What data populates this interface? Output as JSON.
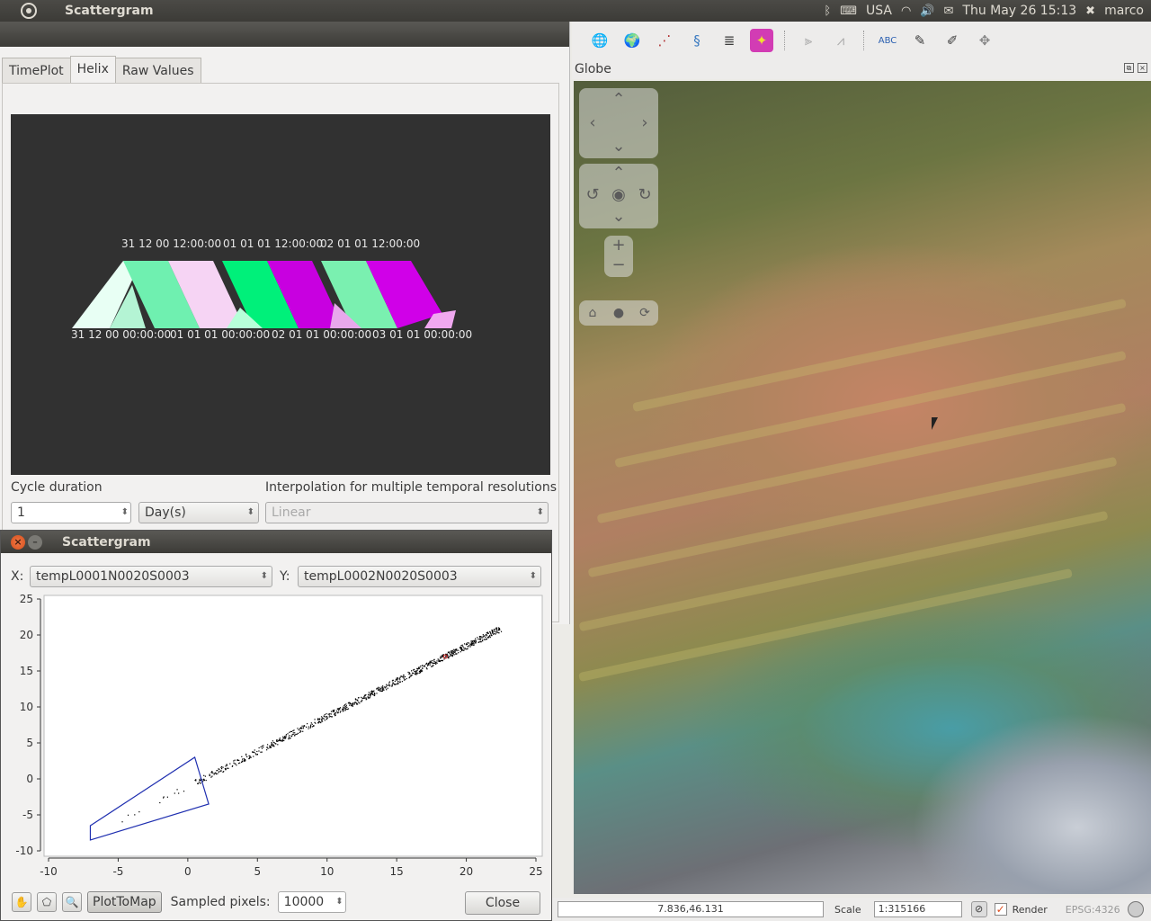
{
  "top_panel": {
    "app_title": "Scattergram",
    "keyboard": "USA",
    "datetime": "Thu May 26 15:13",
    "user": "marco"
  },
  "globe": {
    "title": "Globe"
  },
  "statusbar": {
    "coordinates": "7.836,46.131",
    "scale_label": "Scale",
    "scale_value": "1:315166",
    "render_label": "Render",
    "crs": "EPSG:4326"
  },
  "helix_dialog": {
    "tabs": [
      {
        "label": "TimePlot"
      },
      {
        "label": "Helix"
      },
      {
        "label": "Raw Values"
      }
    ],
    "top_labels": [
      "31 12 00 12:00:00",
      "01 01 01 12:00:00",
      "02 01 01 12:00:00"
    ],
    "bottom_labels": [
      "31 12 00 00:00:00",
      "01 01 01 00:00:00",
      "02 01 01 00:00:00",
      "03 01 01 00:00:00"
    ],
    "cycle_duration_label": "Cycle duration",
    "cycle_duration_value": "1",
    "cycle_unit": "Day(s)",
    "interpolation_label": "Interpolation for multiple temporal resolutions",
    "interpolation_value": "Linear"
  },
  "scatter_dialog": {
    "title": "Scattergram",
    "x_label": "X:",
    "x_value": "tempL0001N0020S0003",
    "y_label": "Y:",
    "y_value": "tempL0002N0020S0003",
    "plot_to_map_label": "PlotToMap",
    "sampled_label": "Sampled pixels:",
    "sampled_value": "10000",
    "close_label": "Close"
  },
  "chart_data": {
    "type": "scatter",
    "xlim": [
      -10,
      25
    ],
    "ylim": [
      -10,
      25
    ],
    "xticks": [
      -10,
      -5,
      0,
      5,
      10,
      15,
      20,
      25
    ],
    "yticks": [
      -10,
      -5,
      0,
      5,
      10,
      15,
      20,
      25
    ],
    "trend": {
      "x_start": -7,
      "y_start": -7.8,
      "x_end": 22.5,
      "y_end": 21
    },
    "selection_polygon": [
      [
        -7,
        -6.5
      ],
      [
        0.5,
        3
      ],
      [
        1.5,
        -3.5
      ],
      [
        -7,
        -8.5
      ]
    ],
    "highlight_point": [
      18.5,
      17
    ]
  }
}
